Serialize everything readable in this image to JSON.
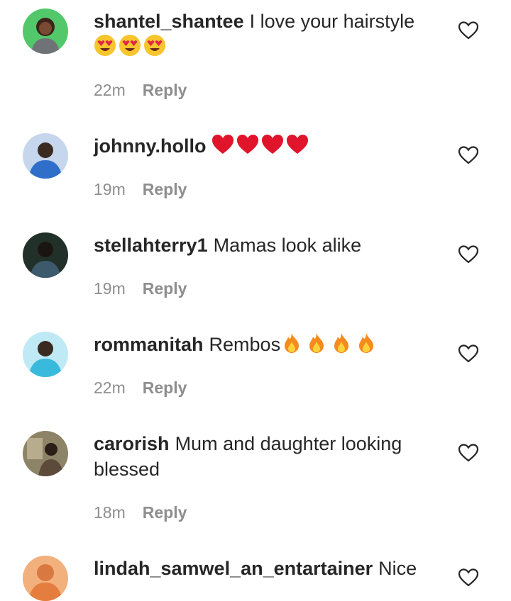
{
  "comments": [
    {
      "username": "shantel_shantee",
      "text": "I love your hairstyle",
      "emoji": [
        "heart-eyes",
        "heart-eyes",
        "heart-eyes"
      ],
      "time": "22m",
      "reply": "Reply",
      "avatar_color": "#4cd06a"
    },
    {
      "username": "johnny.hollo",
      "text": "",
      "emoji": [
        "red-heart",
        "red-heart",
        "red-heart",
        "red-heart"
      ],
      "time": "19m",
      "reply": "Reply",
      "avatar_color": "#6d8fc9"
    },
    {
      "username": "stellahterry1",
      "text": "Mamas look alike",
      "emoji": [],
      "time": "19m",
      "reply": "Reply",
      "avatar_color": "#2b3b35"
    },
    {
      "username": "rommanitah",
      "text": "Rembos",
      "emoji": [
        "fire",
        "fire",
        "fire",
        "fire"
      ],
      "time": "22m",
      "reply": "Reply",
      "avatar_color": "#56c6e3"
    },
    {
      "username": "carorish",
      "text": "Mum and daughter looking blessed",
      "emoji": [],
      "time": "18m",
      "reply": "Reply",
      "avatar_color": "#8a7a5e"
    },
    {
      "username": "lindah_samwel_an_entartainer",
      "text": "Nice",
      "emoji": [],
      "time": "",
      "reply": "",
      "avatar_color": "#e9935a"
    }
  ]
}
